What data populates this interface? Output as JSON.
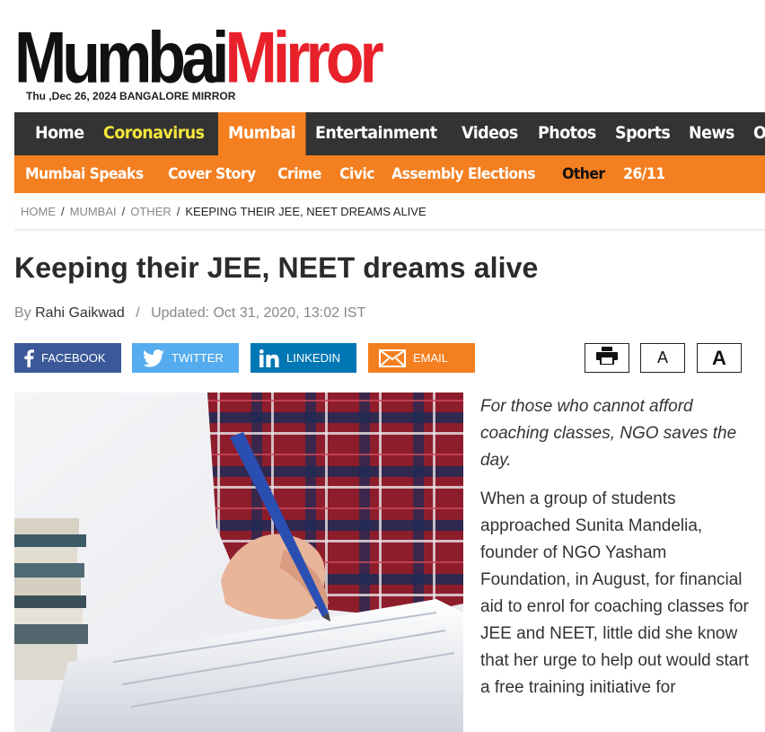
{
  "header": {
    "logo_word1": "Mumbai",
    "logo_word2": "Mirror",
    "dateline": "Thu ,Dec 26, 2024  BANGALORE MIRROR"
  },
  "nav": {
    "main": [
      "Home",
      "Coronavirus",
      "Mumbai",
      "Entertainment",
      "Videos",
      "Photos",
      "Sports",
      "News",
      "Opi"
    ],
    "sub": [
      "Mumbai Speaks",
      "Cover Story",
      "Crime",
      "Civic",
      "Assembly Elections",
      "Other",
      "26/11"
    ]
  },
  "breadcrumb": {
    "home": "HOME",
    "section": "MUMBAI",
    "subsection": "OTHER",
    "current": "KEEPING THEIR JEE, NEET DREAMS ALIVE",
    "separator": "/"
  },
  "article": {
    "title": "Keeping their JEE, NEET dreams alive",
    "by": "By",
    "author": "Rahi Gaikwad",
    "updated": "Updated: Oct 31, 2020, 13:02 IST",
    "summary": "For those who cannot afford coaching classes, NGO saves the day.",
    "body": "When a group of students approached Sunita Mandelia, founder of NGO Yasham Foundation, in August, for financial aid to enrol for coaching classes for JEE and NEET, little did she know that her urge to help out would start a free training initiative for"
  },
  "share": {
    "facebook": "FACEBOOK",
    "twitter": "TWITTER",
    "linkedin": "LINKEDIN",
    "email": "EMAIL"
  },
  "tools": {
    "font_small": "A",
    "font_large": "A",
    "print_icon": "printer-icon"
  },
  "colors": {
    "logo_red": "#e8202a",
    "nav_dark": "#333333",
    "nav_orange": "#f47f20",
    "nav_yellow": "#f5e63b",
    "facebook": "#3b5998",
    "twitter": "#55acee",
    "linkedin": "#0077b5"
  }
}
